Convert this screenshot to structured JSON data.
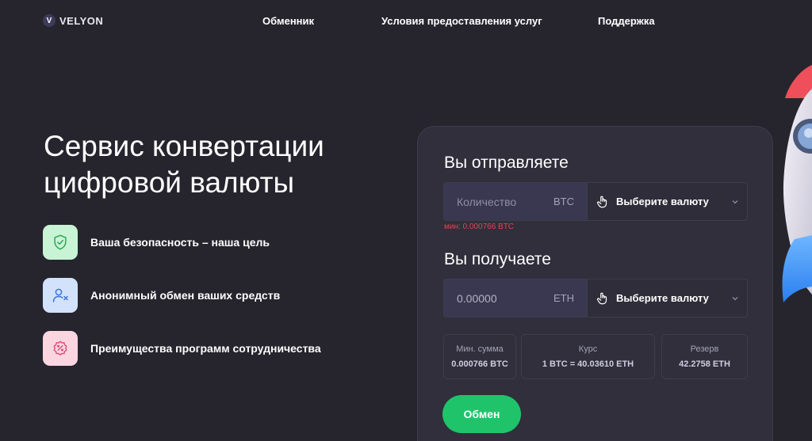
{
  "header": {
    "logo_mark": "V",
    "logo_text": "VELYON",
    "nav": [
      "Обменник",
      "Условия предоставления услуг",
      "Поддержка"
    ]
  },
  "hero": {
    "title_line1": "Сервис конвертации",
    "title_line2": "цифровой валюты",
    "features": [
      {
        "text": "Ваша безопасность – наша цель",
        "icon": "shield-check-icon"
      },
      {
        "text": "Анонимный обмен ваших средств",
        "icon": "user-x-icon"
      },
      {
        "text": "Преимущества программ сотрудничества",
        "icon": "percent-badge-icon"
      }
    ]
  },
  "exchange": {
    "send": {
      "title": "Вы отправляете",
      "amount_placeholder": "Количество",
      "currency": "BTC",
      "select_label": "Выберите валюту",
      "min_note": "мин: 0.000766 BTC"
    },
    "receive": {
      "title": "Вы получаете",
      "amount_value": "0.00000",
      "currency": "ETH",
      "select_label": "Выберите валюту"
    },
    "stats": [
      {
        "label": "Мин. сумма",
        "value": "0.000766 BTC"
      },
      {
        "label": "Курс",
        "value": "1 BTC = 40.03610 ETH"
      },
      {
        "label": "Резерв",
        "value": "42.2758 ETH"
      }
    ],
    "button_label": "Обмен"
  },
  "colors": {
    "background": "#26252e",
    "card": "#302f3b",
    "accent_green": "#1fc46a",
    "error_red": "#e0464e"
  }
}
